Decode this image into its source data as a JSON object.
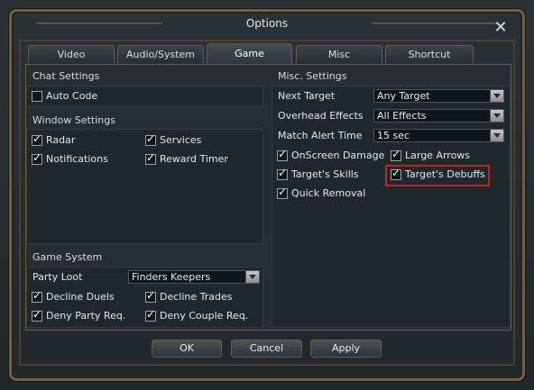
{
  "window": {
    "title": "Options"
  },
  "tabs": [
    {
      "label": "Video"
    },
    {
      "label": "Audio/System"
    },
    {
      "label": "Game"
    },
    {
      "label": "Misc"
    },
    {
      "label": "Shortcut"
    }
  ],
  "chat": {
    "title": "Chat Settings",
    "auto_code": {
      "label": "Auto Code",
      "checked": false
    }
  },
  "window_settings": {
    "title": "Window Settings",
    "radar": "Radar",
    "services": "Services",
    "notifications": "Notifications",
    "reward_timer": "Reward Timer"
  },
  "game_system": {
    "title": "Game System",
    "party_loot_label": "Party Loot",
    "party_loot_value": "Finders Keepers",
    "decline_duels": "Decline Duels",
    "decline_trades": "Decline Trades",
    "deny_party": "Deny Party Req.",
    "deny_couple": "Deny Couple Req."
  },
  "misc": {
    "title": "Misc. Settings",
    "next_target_label": "Next Target",
    "next_target_value": "Any Target",
    "overhead_label": "Overhead Effects",
    "overhead_value": "All Effects",
    "match_alert_label": "Match Alert Time",
    "match_alert_value": "15 sec",
    "onscreen_damage": "OnScreen Damage",
    "large_arrows": "Large Arrows",
    "targets_skills": "Target's Skills",
    "targets_debuffs": "Target's Debuffs",
    "quick_removal": "Quick Removal"
  },
  "buttons": {
    "ok": "OK",
    "cancel": "Cancel",
    "apply": "Apply"
  },
  "colors": {
    "highlight": "#c9201f",
    "frame": "#6d5f4a"
  }
}
